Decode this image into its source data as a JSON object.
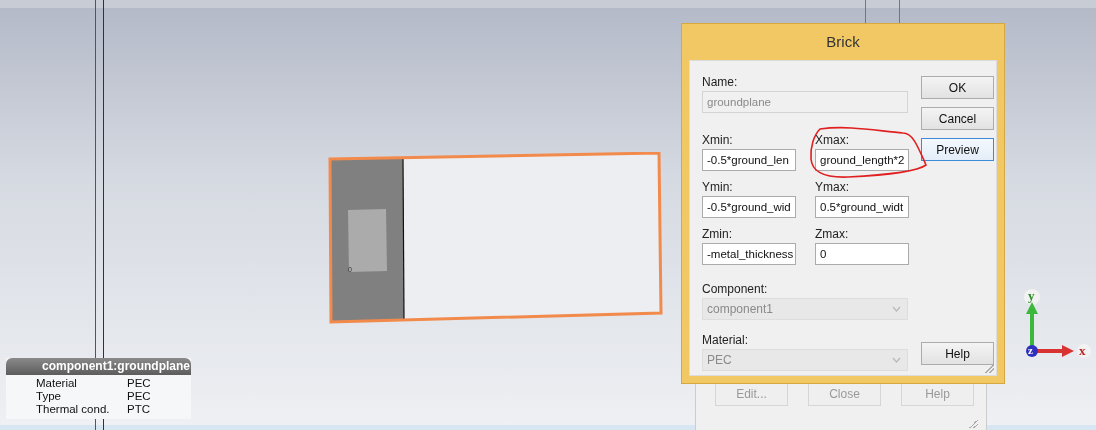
{
  "viewport": {
    "port_label": "0",
    "info_panel": {
      "title": "component1:groundplane",
      "rows": [
        {
          "label": "Material",
          "value": "PEC"
        },
        {
          "label": "Type",
          "value": "PEC"
        },
        {
          "label": "Thermal cond.",
          "value": "PTC"
        }
      ]
    },
    "axes": {
      "x_label": "x",
      "y_label": "y",
      "z_label": "z"
    }
  },
  "background_dialog": {
    "buttons": [
      {
        "label": "Edit...",
        "disabled": true
      },
      {
        "label": "Close",
        "disabled": true
      },
      {
        "label": "Help",
        "disabled": true
      }
    ]
  },
  "dialog": {
    "title": "Brick",
    "name_field": {
      "label": "Name:",
      "value": "groundplane",
      "disabled": true
    },
    "coordinate_fields": [
      {
        "label": "Xmin:",
        "value": "-0.5*ground_len",
        "annotated": false
      },
      {
        "label": "Xmax:",
        "value": "ground_length*2",
        "annotated": true
      },
      {
        "label": "Ymin:",
        "value": "-0.5*ground_wid",
        "annotated": false
      },
      {
        "label": "Ymax:",
        "value": "0.5*ground_widt",
        "annotated": false
      },
      {
        "label": "Zmin:",
        "value": "-metal_thickness",
        "annotated": false
      },
      {
        "label": "Zmax:",
        "value": "0",
        "annotated": false
      }
    ],
    "component_field": {
      "label": "Component:",
      "value": "component1",
      "disabled": true
    },
    "material_field": {
      "label": "Material:",
      "value": "PEC",
      "disabled": true
    },
    "buttons": [
      {
        "label": "OK",
        "focused": false
      },
      {
        "label": "Cancel",
        "focused": false
      },
      {
        "label": "Preview",
        "focused": true
      }
    ],
    "help_button": {
      "label": "Help",
      "focused": false
    }
  }
}
